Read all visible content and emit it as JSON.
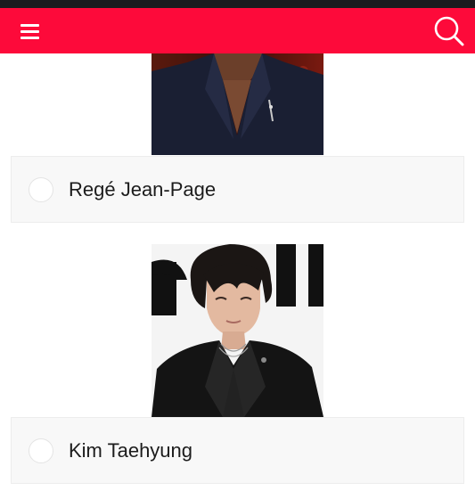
{
  "header": {
    "menu_icon": "hamburger-menu-icon",
    "search_icon": "search-icon",
    "bar_color": "#fd0a3a",
    "status_color": "#1b1b1f"
  },
  "options": [
    {
      "label": "Regé Jean-Page",
      "photo": "person-photo"
    },
    {
      "label": "Kim Taehyung",
      "photo": "person-photo"
    }
  ]
}
